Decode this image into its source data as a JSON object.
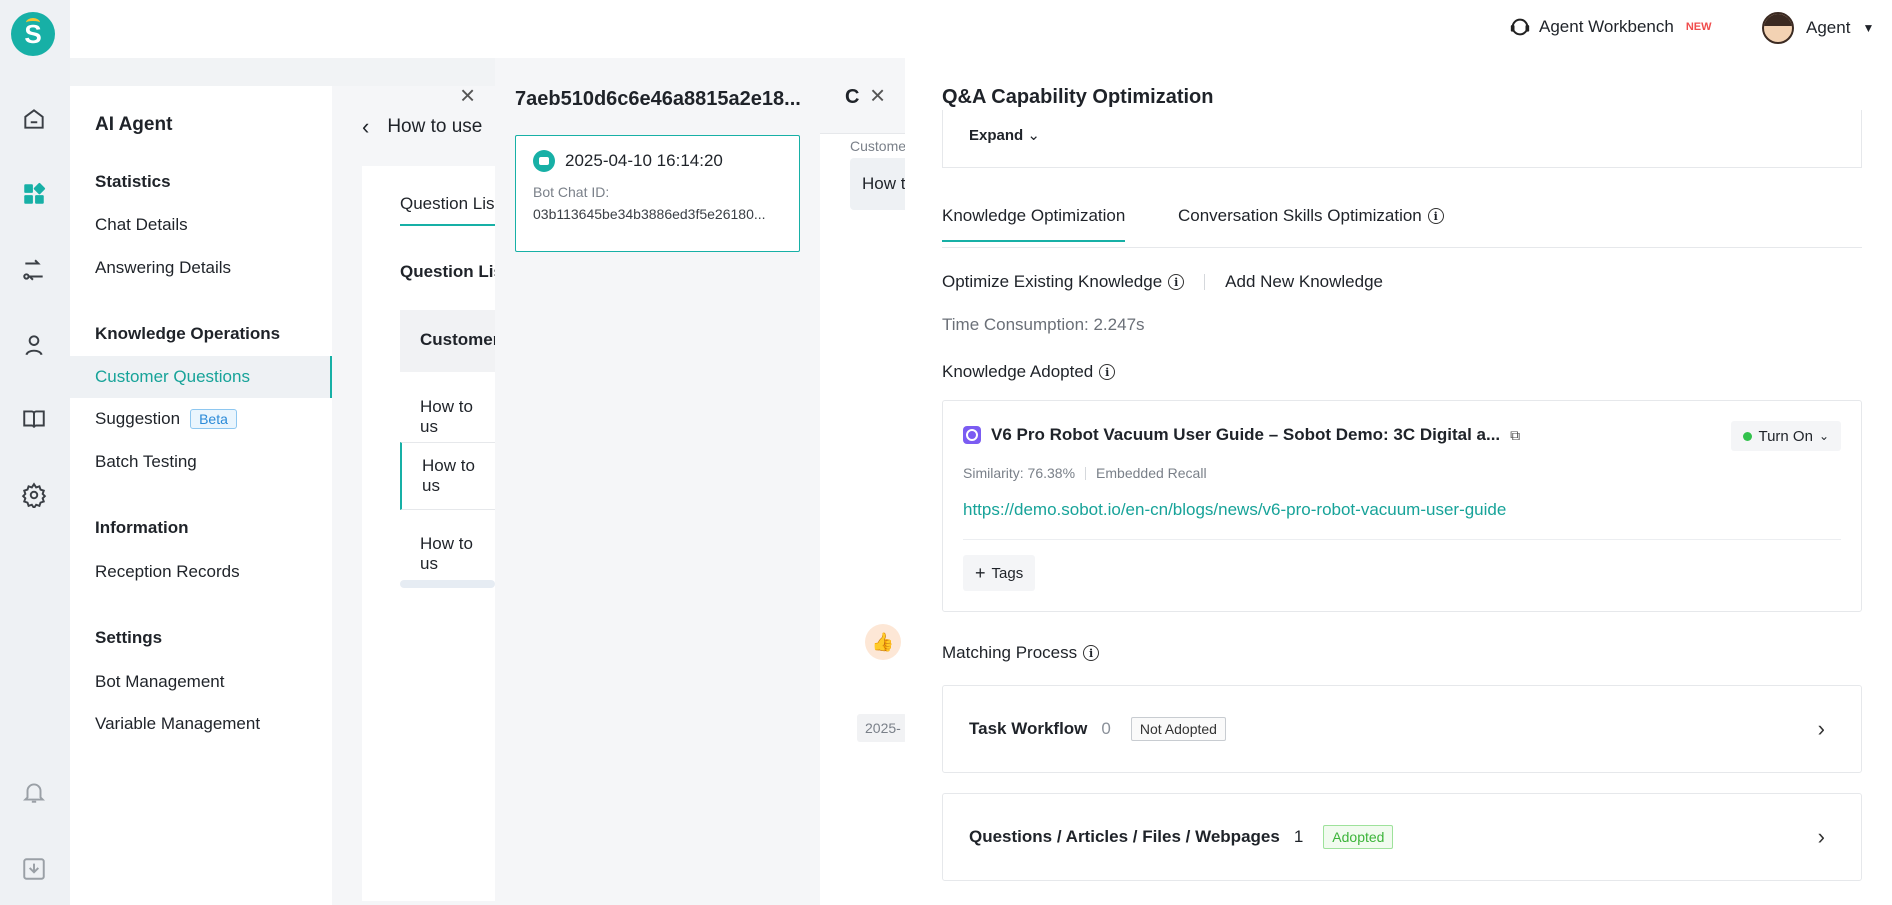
{
  "topbar": {
    "workbench_label": "Agent Workbench",
    "new_badge": "NEW",
    "agent_label": "Agent"
  },
  "sidebar": {
    "title": "AI Agent",
    "sections": {
      "statistics": "Statistics",
      "knowledge_ops": "Knowledge Operations",
      "information": "Information",
      "settings": "Settings"
    },
    "items": {
      "chat_details": "Chat Details",
      "answering_details": "Answering Details",
      "customer_questions": "Customer Questions",
      "suggestion": "Suggestion",
      "beta": "Beta",
      "batch_testing": "Batch Testing",
      "reception_records": "Reception Records",
      "bot_management": "Bot Management",
      "variable_management": "Variable Management"
    }
  },
  "content": {
    "heading": "How to use",
    "tab": "Question Lis",
    "list_title": "Question Lis",
    "header_cell": "Customer",
    "rows": [
      "How to us",
      "How to us",
      "How to us"
    ]
  },
  "drawer": {
    "title": "7aeb510d6c6e46a8815a2e18...",
    "chat_time": "2025-04-10 16:14:20",
    "chat_id_label": "Bot Chat ID:",
    "chat_id": "03b113645be34b3886ed3f5e26180..."
  },
  "chat": {
    "letter": "C",
    "customer_label": "Custome",
    "bubble": "How t",
    "date": "2025-"
  },
  "qa": {
    "title": "Q&A Capability Optimization",
    "expand": "Expand",
    "tabs": [
      "Knowledge Optimization",
      "Conversation Skills Optimization"
    ],
    "subtabs": [
      "Optimize Existing Knowledge",
      "Add New Knowledge"
    ],
    "time": "Time Consumption: 2.247s",
    "adopted_title": "Knowledge Adopted",
    "knowledge": {
      "title": "V6 Pro Robot Vacuum User Guide – Sobot Demo: 3C Digital a...",
      "status": "Turn On",
      "similarity": "Similarity: 76.38%",
      "recall": "Embedded Recall",
      "link": "https://demo.sobot.io/en-cn/blogs/news/v6-pro-robot-vacuum-user-guide",
      "tags": "Tags"
    },
    "matching_title": "Matching Process",
    "process": [
      {
        "name": "Task Workflow",
        "count": "0",
        "badge": "Not Adopted"
      },
      {
        "name": "Questions / Articles / Files / Webpages",
        "count": "1",
        "badge": "Adopted"
      }
    ]
  }
}
